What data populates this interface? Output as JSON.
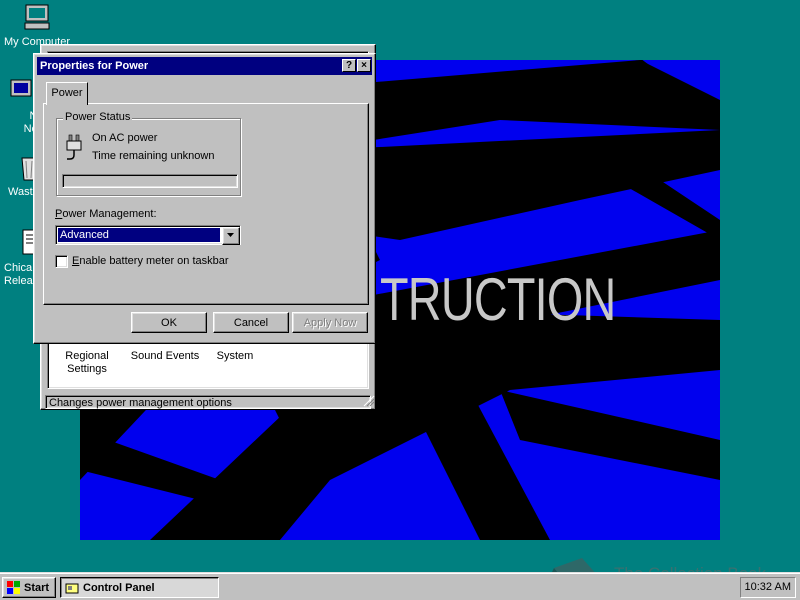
{
  "desktop": {
    "icons": [
      {
        "label": "My Computer",
        "icon": "computer-icon"
      },
      {
        "label": "Net Neigh",
        "icon": "network-icon"
      },
      {
        "label": "Waste",
        "icon": "recycle-bin-icon"
      },
      {
        "label": "Chica Releas",
        "icon": "document-icon"
      }
    ],
    "wallpaper_text": "TRUCTION"
  },
  "control_panel": {
    "items": [
      {
        "label": "Regional Settings"
      },
      {
        "label": "Sound Events"
      },
      {
        "label": "System"
      }
    ],
    "status_text": "Changes power management options"
  },
  "dialog": {
    "title": "Properties for Power",
    "help_button": "?",
    "close_button": "×",
    "tab_label": "Power",
    "power_status": {
      "group_label": "Power Status",
      "source": "On AC power",
      "time_remaining": "Time remaining unknown",
      "battery_level_percent": 0
    },
    "power_management": {
      "label": "Power Management:",
      "selected": "Advanced"
    },
    "battery_meter": {
      "label": "Enable battery meter on taskbar",
      "checked": false
    },
    "buttons": {
      "ok": "OK",
      "cancel": "Cancel",
      "apply": "Apply Now"
    }
  },
  "taskbar": {
    "start_label": "Start",
    "task_label": "Control Panel",
    "clock": "10:32 AM"
  },
  "watermark": "The Collection Book",
  "colors": {
    "desktop": "#008080",
    "title_bar": "#000080",
    "wallpaper_blue": "#0000ee"
  }
}
